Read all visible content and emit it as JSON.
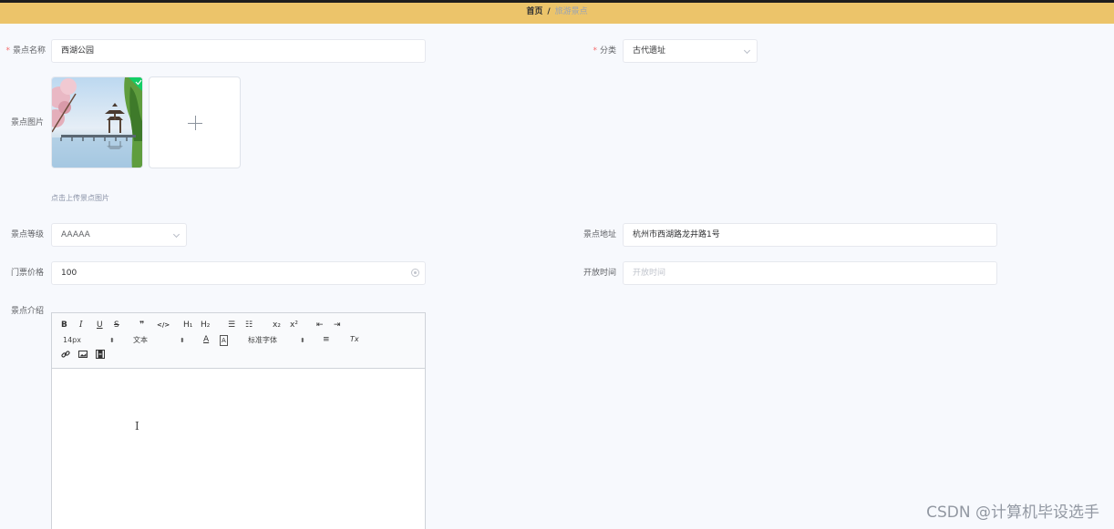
{
  "breadcrumb": {
    "home": "首页",
    "separator": "/",
    "current": "旅游景点"
  },
  "form": {
    "name": {
      "label": "景点名称",
      "value": "西湖公园",
      "required": true
    },
    "category": {
      "label": "分类",
      "value": "古代遗址",
      "required": true
    },
    "image": {
      "label": "景点图片",
      "hint": "点击上传景点图片",
      "upload_icon": "plus-icon"
    },
    "level": {
      "label": "景点等级",
      "value": "AAAAA"
    },
    "address": {
      "label": "景点地址",
      "value": "杭州市西湖路龙井路1号"
    },
    "price": {
      "label": "门票价格",
      "value": "100"
    },
    "open_time": {
      "label": "开放时间",
      "placeholder": "开放时间"
    },
    "intro": {
      "label": "景点介绍"
    }
  },
  "editor": {
    "font_size": "14px",
    "header_select": "文本",
    "font_family": "标准字体",
    "buttons": {
      "bold": "B",
      "italic": "I",
      "underline": "U",
      "strike": "S",
      "blockquote": "❞",
      "code": "</>",
      "h1": "H₁",
      "h2": "H₂",
      "ordered_list": "☰",
      "bullet_list": "☷",
      "subscript": "x₂",
      "superscript": "x²",
      "outdent": "⇤",
      "indent": "⇥",
      "color": "A",
      "background": "A",
      "align": "≡",
      "clean": "Tx",
      "link": "🔗",
      "image": "▣",
      "video": "▤"
    }
  },
  "colors": {
    "topbar": "#ecc46a",
    "required": "#f56c6c",
    "success": "#13ce66"
  },
  "watermark": "CSDN @计算机毕设选手"
}
